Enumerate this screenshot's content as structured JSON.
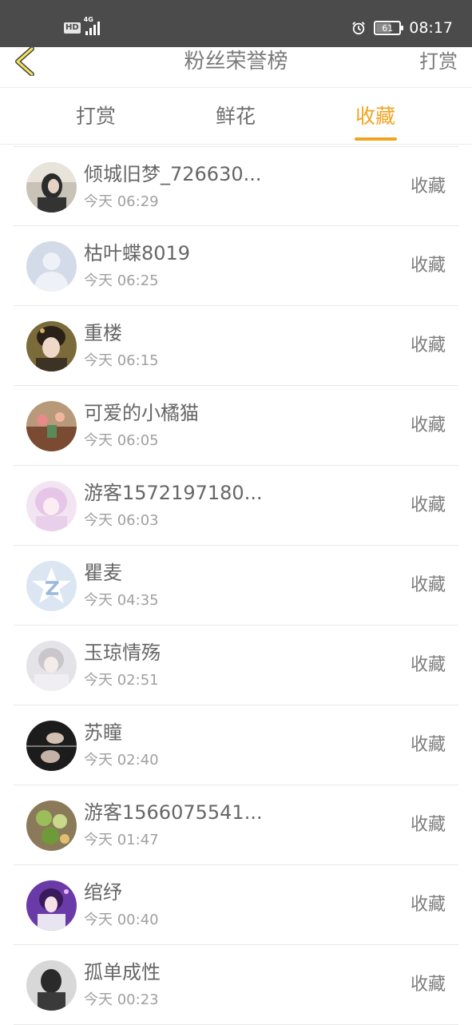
{
  "status_bar": {
    "hd_label": "HD",
    "network_label": "4G",
    "battery_level": "61",
    "time": "08:17"
  },
  "header": {
    "title": "粉丝荣誉榜",
    "action_label": "打赏"
  },
  "tabs": [
    {
      "label": "打赏",
      "active": false
    },
    {
      "label": "鲜花",
      "active": false
    },
    {
      "label": "收藏",
      "active": true
    }
  ],
  "accent_color": "#f0a420",
  "list": [
    {
      "name": "倾城旧梦_726630...",
      "time": "今天 06:29",
      "action": "收藏",
      "avatar": "photo-avatar"
    },
    {
      "name": "枯叶蝶8019",
      "time": "今天 06:25",
      "action": "收藏",
      "avatar": "default-user-avatar"
    },
    {
      "name": "重楼",
      "time": "今天 06:15",
      "action": "收藏",
      "avatar": "photo-avatar"
    },
    {
      "name": "可爱的小橘猫",
      "time": "今天 06:05",
      "action": "收藏",
      "avatar": "photo-avatar"
    },
    {
      "name": "游客1572197180...",
      "time": "今天 06:03",
      "action": "收藏",
      "avatar": "photo-avatar"
    },
    {
      "name": "瞿麦",
      "time": "今天 04:35",
      "action": "收藏",
      "avatar": "qzone-star-avatar"
    },
    {
      "name": "玉琼情殇",
      "time": "今天 02:51",
      "action": "收藏",
      "avatar": "photo-avatar"
    },
    {
      "name": "苏瞳",
      "time": "今天 02:40",
      "action": "收藏",
      "avatar": "photo-avatar"
    },
    {
      "name": "游客1566075541...",
      "time": "今天 01:47",
      "action": "收藏",
      "avatar": "photo-avatar"
    },
    {
      "name": "绾纾",
      "time": "今天 00:40",
      "action": "收藏",
      "avatar": "photo-avatar"
    },
    {
      "name": "孤单成性",
      "time": "今天 00:23",
      "action": "收藏",
      "avatar": "photo-avatar"
    }
  ]
}
